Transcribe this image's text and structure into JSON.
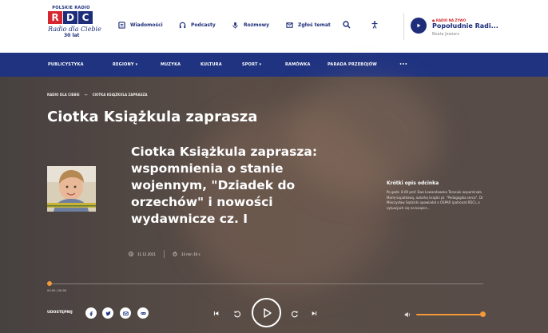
{
  "header": {
    "brand_top": "POLSKIE RADIO",
    "brand_letters": [
      "R",
      "D",
      "C"
    ],
    "brand_script": "Radio dla Ciebie",
    "brand_anniversary": "30 lat",
    "links": [
      {
        "label": "Wiadomości",
        "icon": "news-icon"
      },
      {
        "label": "Podcasty",
        "icon": "headphones-icon"
      },
      {
        "label": "Rozmowy",
        "icon": "microphone-icon"
      },
      {
        "label": "Zgłoś temat",
        "icon": "envelope-icon"
      }
    ],
    "search_icon": "search-icon",
    "accessibility_icon": "accessibility-icon",
    "live": {
      "tag": "● RADIO NA ŻYWO",
      "title": "Popołudnie Radi...",
      "host": "Beata Jewiarz"
    }
  },
  "menu": {
    "items": [
      "PUBLICYSTYKA",
      "REGIONY ▾",
      "MUZYKA",
      "KULTURA",
      "SPORT ▾",
      "RAMÓWKA",
      "PARADA PRZEBOJÓW",
      "•••"
    ]
  },
  "hero": {
    "breadcrumbs": [
      "RADIO DLA CIEBIE",
      "—",
      "CIOTKA KSIĄŻKULA ZAPRASZA"
    ],
    "page_title": "Ciotka Książkula zaprasza",
    "episode_title": "Ciotka Książkula zaprasza: wspomnienia o stanie wojennym, \"Dziadek do orzechów\" i nowości wydawnicze cz. I",
    "date": "11.12.2021",
    "duration": "33 min 10 s",
    "desc_heading": "Krótki opis odcinka",
    "desc_text": "Po godz. 8.00 prof. Ewa Lewandowska Tarasiuk wspominała Marię Łopatkową, autorkę książki pt. \"Pedagogika serca\". Dr Mieczysław Sędzicki opowiadał o OSPAR (patronat RDC), o sytuacjach się na książce..."
  },
  "player": {
    "time": "00:00 | 00:00",
    "progress": 0,
    "volume": 1.0,
    "share_label": "UDOSTĘPNIJ",
    "share_icons": [
      "facebook-icon",
      "twitter-icon",
      "email-icon",
      "link-icon"
    ],
    "accent_color": "#f2993a"
  },
  "colors": {
    "brand_navy": "#1f3380",
    "brand_red": "#d6262f"
  }
}
